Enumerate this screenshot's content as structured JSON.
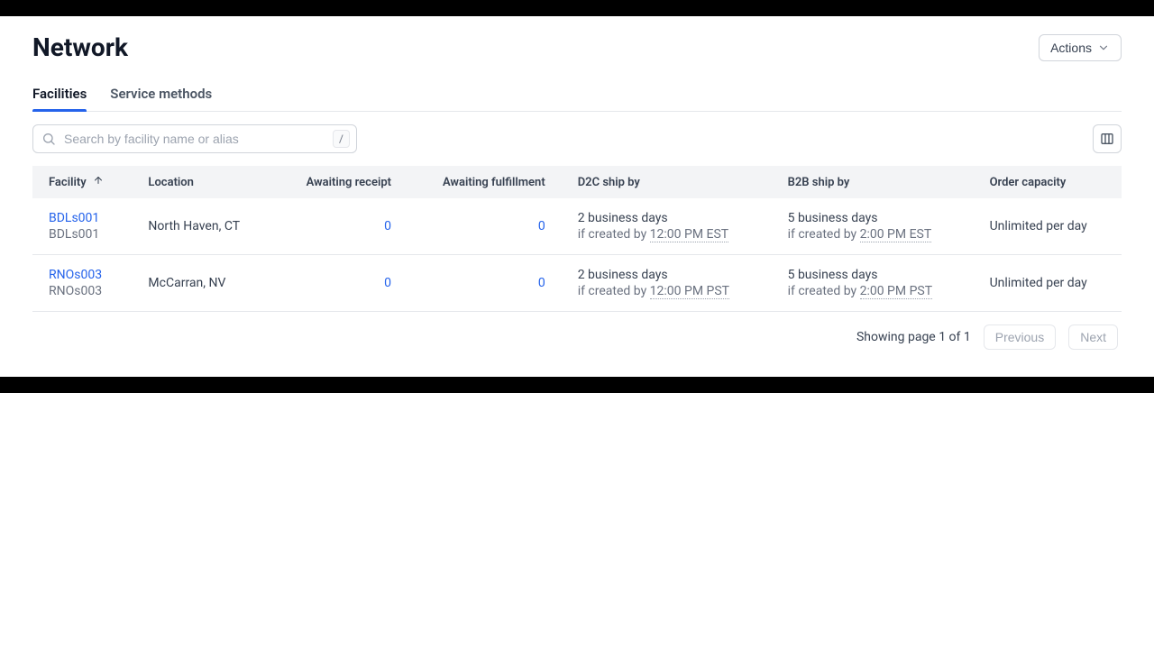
{
  "header": {
    "title": "Network",
    "actions_label": "Actions"
  },
  "tabs": {
    "facilities": "Facilities",
    "service_methods": "Service methods"
  },
  "search": {
    "placeholder": "Search by facility name or alias",
    "shortcut": "/"
  },
  "columns": {
    "facility": "Facility",
    "location": "Location",
    "awaiting_receipt": "Awaiting receipt",
    "awaiting_fulfillment": "Awaiting fulfillment",
    "d2c_ship_by": "D2C ship by",
    "b2b_ship_by": "B2B ship by",
    "order_capacity": "Order capacity"
  },
  "rows": [
    {
      "name": "BDLs001",
      "alias": "BDLs001",
      "location": "North Haven, CT",
      "awaiting_receipt": "0",
      "awaiting_fulfillment": "0",
      "d2c_main": "2 business days",
      "d2c_prefix": "if created by ",
      "d2c_time": "12:00 PM EST",
      "b2b_main": "5 business days",
      "b2b_prefix": "if created by ",
      "b2b_time": "2:00 PM EST",
      "capacity": "Unlimited per day"
    },
    {
      "name": "RNOs003",
      "alias": "RNOs003",
      "location": "McCarran, NV",
      "awaiting_receipt": "0",
      "awaiting_fulfillment": "0",
      "d2c_main": "2 business days",
      "d2c_prefix": "if created by ",
      "d2c_time": "12:00 PM PST",
      "b2b_main": "5 business days",
      "b2b_prefix": "if created by ",
      "b2b_time": "2:00 PM PST",
      "capacity": "Unlimited per day"
    }
  ],
  "pagination": {
    "status": "Showing page 1 of 1",
    "previous": "Previous",
    "next": "Next"
  }
}
